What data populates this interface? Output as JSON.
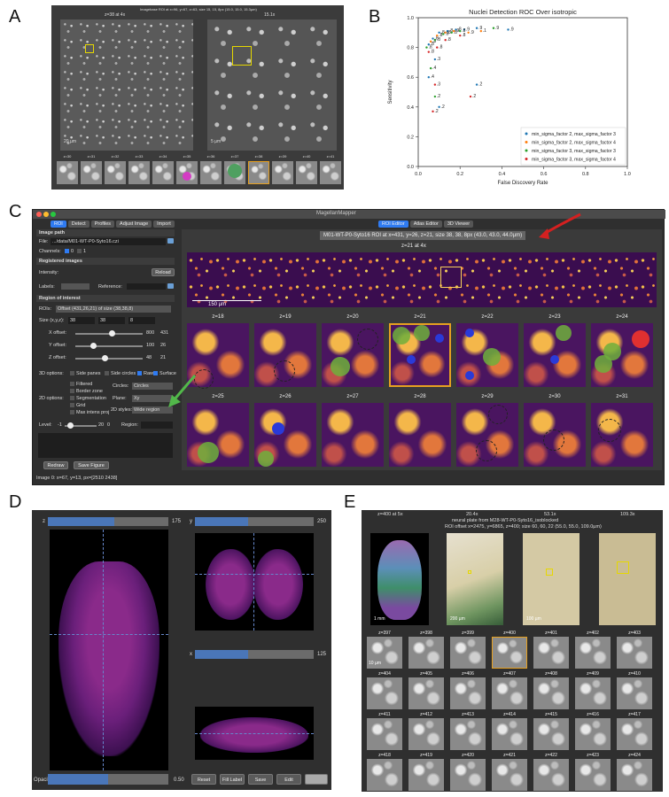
{
  "panels": {
    "a": "A",
    "b": "B",
    "c": "C",
    "d": "D",
    "e": "E"
  },
  "a": {
    "header": "Imagebase ROI at x=96, y=67, z=63, size 15, 15, 8px (15.0, 15.0, 15.3µm)",
    "left_title": "z=38 at 4x",
    "right_title": "15.1x",
    "scale_left": "20 µm",
    "scale_right": "5 µm",
    "ztiles": [
      "z=30",
      "z=31",
      "z=32",
      "z=33",
      "z=34",
      "z=35",
      "z=36",
      "z=37",
      "z=38",
      "z=39",
      "z=40",
      "z=41"
    ]
  },
  "chart_data": {
    "type": "scatter",
    "title": "Nuclei Detection ROC Over isotropic",
    "xlabel": "False Discovery Rate",
    "ylabel": "Sensitivity",
    "xlim": [
      0.0,
      1.0
    ],
    "ylim": [
      0.0,
      1.0
    ],
    "xticks": [
      "0.0",
      "0.2",
      "0.4",
      "0.6",
      "0.8",
      "1.0"
    ],
    "yticks": [
      "0.0",
      "0.2",
      "0.4",
      "0.6",
      "0.8",
      "1.0"
    ],
    "legend_position": "lower-right",
    "series": [
      {
        "name": "min_sigma_factor 2, max_sigma_factor 3",
        "color": "#1f77b4",
        "points": [
          [
            0.05,
            0.82,
            ".8"
          ],
          [
            0.07,
            0.86,
            ".8"
          ],
          [
            0.1,
            0.9,
            ".8"
          ],
          [
            0.14,
            0.91,
            ".8"
          ],
          [
            0.18,
            0.92,
            ".8"
          ],
          [
            0.22,
            0.92,
            ".9"
          ],
          [
            0.28,
            0.93,
            ".9"
          ],
          [
            0.43,
            0.92,
            ".9"
          ],
          [
            0.08,
            0.72,
            ".3"
          ],
          [
            0.28,
            0.55,
            ".2"
          ],
          [
            0.05,
            0.6,
            ".4"
          ],
          [
            0.1,
            0.4,
            ".2"
          ]
        ]
      },
      {
        "name": "min_sigma_factor 2, max_sigma_factor 4",
        "color": "#ff7f0e",
        "points": [
          [
            0.06,
            0.84,
            ".8"
          ],
          [
            0.09,
            0.88,
            ".8"
          ],
          [
            0.13,
            0.9,
            ".8"
          ],
          [
            0.17,
            0.91,
            ".9"
          ],
          [
            0.24,
            0.9,
            ".9"
          ],
          [
            0.3,
            0.91,
            ".1"
          ]
        ]
      },
      {
        "name": "min_sigma_factor 3, max_sigma_factor 3",
        "color": "#2ca02c",
        "points": [
          [
            0.04,
            0.8,
            ".8"
          ],
          [
            0.08,
            0.85,
            ".8"
          ],
          [
            0.12,
            0.89,
            ".8"
          ],
          [
            0.16,
            0.9,
            ".8"
          ],
          [
            0.2,
            0.91,
            ".8"
          ],
          [
            0.36,
            0.93,
            ".9"
          ],
          [
            0.06,
            0.66,
            ".4"
          ],
          [
            0.08,
            0.47,
            ".2"
          ]
        ]
      },
      {
        "name": "min_sigma_factor 3, max_sigma_factor 4",
        "color": "#d62728",
        "points": [
          [
            0.05,
            0.77,
            ".8"
          ],
          [
            0.09,
            0.8,
            ".8"
          ],
          [
            0.13,
            0.85,
            ".8"
          ],
          [
            0.2,
            0.88,
            ".8"
          ],
          [
            0.08,
            0.55,
            ".3"
          ],
          [
            0.25,
            0.47,
            ".2"
          ],
          [
            0.07,
            0.37,
            ".2"
          ]
        ]
      }
    ]
  },
  "c": {
    "window_title": "MagellanMapper",
    "left_tabs": [
      "ROI",
      "Detect",
      "Profiles",
      "Adjust Image",
      "Import"
    ],
    "right_tabs": [
      "ROI Editor",
      "Atlas Editor",
      "3D Viewer"
    ],
    "image_path_header": "Image path",
    "file_label": "File:",
    "file_value": ".../data/M01-WT-P0-Syto16.czi",
    "channels_label": "Channels:",
    "channel_0": "0",
    "channel_1": "1",
    "registered_header": "Registered images",
    "intensity_label": "Intensity:",
    "reload_button": "Reload",
    "labels_label": "Labels:",
    "reference_label": "Reference:",
    "roi_header": "Region of interest",
    "rois_label": "ROIs:",
    "rois_value": "Offset (431,26,21) of size (38,38,8)",
    "size_label": "Size (x,y,z):",
    "size_values": [
      "38",
      "38",
      "8"
    ],
    "x_offset_label": "X offset:",
    "x_offset_max": "800",
    "x_offset_value": "431",
    "x_offset_level": 0.54,
    "y_offset_label": "Y offset:",
    "y_offset_max": "100",
    "y_offset_value": "26",
    "y_offset_level": 0.26,
    "z_offset_label": "Z offset:",
    "z_offset_max": "48",
    "z_offset_value": "21",
    "z_offset_level": 0.44,
    "options3d_label": "3D options:",
    "side_panes": "Side panes",
    "side_circles": "Side circles",
    "raw": "Raw",
    "surface": "Surface",
    "options2d_label": "2D options:",
    "filtered": "Filtered",
    "border_zone": "Border zone",
    "segmentation": "Segmentation",
    "grid": "Grid",
    "max_intens": "Max intens proj",
    "circles_label": "Circles:",
    "circles_value": "Circles",
    "plane_label": "Plane:",
    "plane_value": "Xy",
    "styles_label": "2D styles:",
    "styles_value": "Wide region",
    "level_label": "Level:",
    "level_min": "-1",
    "level_max": "20",
    "level_value": "0",
    "region_label": "Region:",
    "redraw_button": "Redraw",
    "save_button": "Save Figure",
    "status": "Image 0: x=67, y=13, px=[2510 2438]",
    "roi_title": "M01-WT-P0-Syto16 ROI at x=431, y=26, z=21, size 38, 38, 8px (43.0, 43.0, 44.0µm)",
    "overview_title": "z=21 at 4x",
    "scale": "150 µm",
    "row1": [
      "z=18",
      "z=19",
      "z=20",
      "z=21",
      "z=22",
      "z=23",
      "z=24"
    ],
    "row2": [
      "z=25",
      "z=26",
      "z=27",
      "z=28",
      "z=29",
      "z=30",
      "z=31"
    ]
  },
  "d": {
    "z_label": "z",
    "z_value": "175",
    "z_level": 0.55,
    "y_label": "y",
    "y_value": "250",
    "y_level": 0.45,
    "x_label": "x",
    "x_value": "125",
    "x_level": 0.45,
    "opacity_label": "Opacity",
    "opacity_value": "0.50",
    "opacity_level": 0.5,
    "buttons": [
      "Reset",
      "Fill Label",
      "Save",
      "Edit"
    ]
  },
  "e": {
    "titles": [
      "z=400 at 5x",
      "20.4x",
      "53.1x",
      "109.3x"
    ],
    "subtitle": "neural plate from M28-WT-P0-Syto16_isoblocked",
    "roi_line": "ROI offset x=2475, y=6865, z=400; size 60, 60, 22 (55.0, 55.0, 109.0µm)",
    "scale_1": "1 mm",
    "scale_2": "200 µm",
    "scale_3": "100 µm",
    "scale_4": "10 µm",
    "grid": [
      [
        "z=397",
        "z=398",
        "z=399",
        "z=400",
        "z=401",
        "z=402",
        "z=403"
      ],
      [
        "z=404",
        "z=405",
        "z=406",
        "z=407",
        "z=408",
        "z=409",
        "z=410"
      ],
      [
        "z=411",
        "z=412",
        "z=413",
        "z=414",
        "z=415",
        "z=416",
        "z=417"
      ],
      [
        "z=418",
        "z=419",
        "z=420",
        "z=421",
        "z=422",
        "z=423",
        "z=424"
      ]
    ]
  }
}
